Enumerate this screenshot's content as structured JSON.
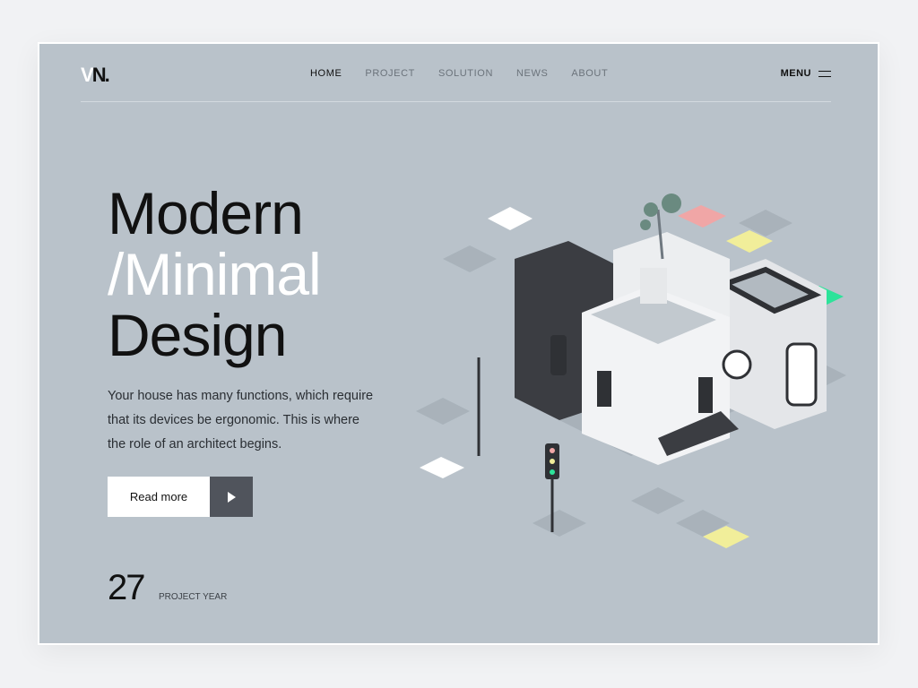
{
  "logo": {
    "text": "VN."
  },
  "nav": {
    "items": [
      {
        "label": "HOME",
        "active": true
      },
      {
        "label": "PROJECT"
      },
      {
        "label": "SOLUTION"
      },
      {
        "label": "NEWS"
      },
      {
        "label": "ABOUT"
      }
    ],
    "menu_label": "MENU"
  },
  "hero": {
    "line1": "Modern",
    "line2": "/Minimal",
    "line3": "Design",
    "description": "Your house has many functions, which require that its devices be ergonomic. This is where the role of an architect begins.",
    "cta_label": "Read more"
  },
  "stat": {
    "value": "27",
    "label": "PROJECT YEAR"
  },
  "colors": {
    "background": "#b9c2ca",
    "accent_pink": "#f0a6a6",
    "accent_yellow": "#f1ee9a",
    "accent_green": "#2de39a"
  }
}
